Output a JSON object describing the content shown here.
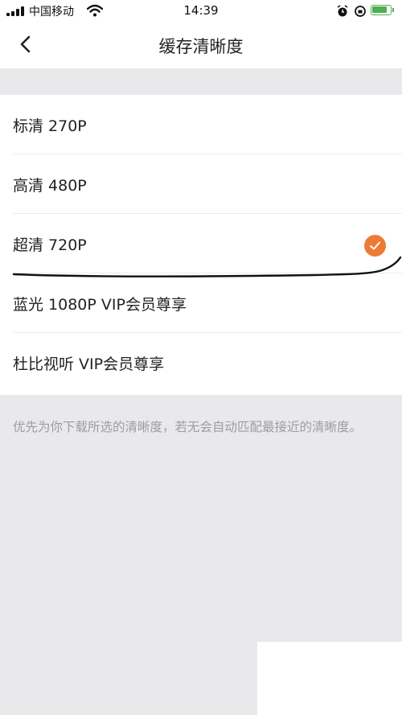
{
  "status_bar": {
    "carrier": "中国移动",
    "time": "14:39",
    "icons": [
      "signal-icon",
      "wifi-icon",
      "alarm-icon",
      "orientation-lock-icon",
      "battery-charging-icon"
    ]
  },
  "header": {
    "title": "缓存清晰度"
  },
  "options": [
    {
      "label": "标清 270P",
      "selected": false
    },
    {
      "label": "高清 480P",
      "selected": false
    },
    {
      "label": "超清 720P",
      "selected": true
    },
    {
      "label": "蓝光 1080P VIP会员尊享",
      "selected": false
    },
    {
      "label": "杜比视听 VIP会员尊享",
      "selected": false
    }
  ],
  "footer_note": "优先为你下载所选的清晰度，若无会自动匹配最接近的清晰度。",
  "colors": {
    "accent": "#ed7b35",
    "background": "#e9e9ec",
    "note_text": "#9c9ca3"
  }
}
